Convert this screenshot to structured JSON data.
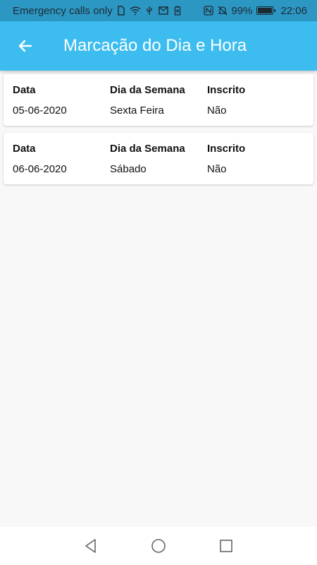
{
  "status_bar": {
    "carrier": "Emergency calls only",
    "battery": "99%",
    "time": "22:06",
    "icons": [
      "sim-icon",
      "wifi-icon",
      "usb-icon",
      "mail-icon",
      "battery-saver-icon",
      "nfc-icon",
      "mute-icon",
      "battery-icon"
    ]
  },
  "app_bar": {
    "title": "Marcação do Dia e Hora",
    "background": "#3dbcef"
  },
  "entries": [
    {
      "headers": [
        "Data",
        "Dia da Semana",
        "Inscrito"
      ],
      "data": "05-06-2020",
      "dia_da_semana": "Sexta Feira",
      "inscrito": "Não"
    },
    {
      "headers": [
        "Data",
        "Dia da Semana",
        "Inscrito"
      ],
      "data": "06-06-2020",
      "dia_da_semana": "Sábado",
      "inscrito": "Não"
    }
  ]
}
